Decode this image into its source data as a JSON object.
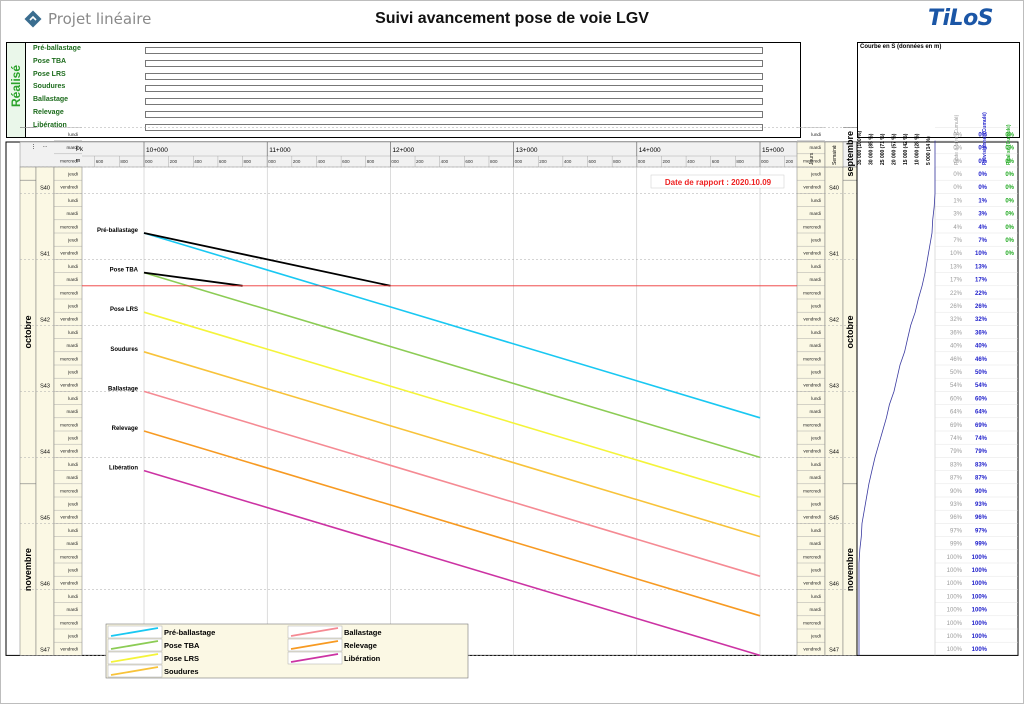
{
  "header": {
    "logo_text": "Projet linéaire",
    "title": "Suivi avancement pose de voie LGV",
    "brand": "TiLoS"
  },
  "realise": {
    "label": "Réalisé",
    "tasks": [
      "Pré-ballastage",
      "Pose TBA",
      "Pose LRS",
      "Soudures",
      "Ballastage",
      "Relevage",
      "Libération"
    ]
  },
  "axis": {
    "pk_label": "Pk",
    "m_label": "m",
    "pk_major": [
      "10+000",
      "11+000",
      "12+000",
      "13+000",
      "14+000",
      "15+000"
    ],
    "pk_minor": [
      "800",
      "900",
      "200",
      "400",
      "600",
      "800"
    ],
    "pk_minor_right": [
      "000",
      "200"
    ],
    "jours_label": "Jours",
    "semaine_label": "Semaine"
  },
  "calendar": {
    "weeks": [
      "...",
      "S40",
      "S41",
      "S42",
      "S43",
      "S44",
      "S45",
      "S46",
      "S47"
    ],
    "days_first_week": [
      "lundi",
      "mardi",
      "mercredi"
    ],
    "days_s40": [
      "jeudi",
      "vendredi"
    ],
    "days": [
      "lundi",
      "mardi",
      "mercredi",
      "jeudi",
      "vendredi"
    ],
    "months": [
      "septembre",
      "octobre",
      "novembre"
    ]
  },
  "report_date": "Date de rapport : 2020.10.09",
  "s_curve": {
    "title": "Courbe en S (données en m)",
    "scale_labels": [
      "35 000 (100 %)",
      "30 000 (85 %)",
      "25 000 (71 %)",
      "20 000 (57 %)",
      "15 000 (42 %)",
      "10 000 (28 %)",
      "5 000 (14 %)"
    ],
    "col_reste": "Reste à faire (Cumulé)",
    "col_prev": "Prévisionnel (Cumulé)",
    "col_real": "Réalisé (Cumulé)",
    "rows": [
      {
        "r": "0%",
        "p": "0%",
        "q": "0%"
      },
      {
        "r": "0%",
        "p": "0%",
        "q": "0%"
      },
      {
        "r": "0%",
        "p": "0%",
        "q": "0%"
      },
      {
        "r": "0%",
        "p": "0%",
        "q": "0%"
      },
      {
        "r": "0%",
        "p": "0%",
        "q": "0%"
      },
      {
        "r": "1%",
        "p": "1%",
        "q": "0%"
      },
      {
        "r": "3%",
        "p": "3%",
        "q": "0%"
      },
      {
        "r": "4%",
        "p": "4%",
        "q": "0%"
      },
      {
        "r": "7%",
        "p": "7%",
        "q": "0%"
      },
      {
        "r": "10%",
        "p": "10%",
        "q": "0%"
      },
      {
        "r": "13%",
        "p": "13%",
        "q": ""
      },
      {
        "r": "17%",
        "p": "17%",
        "q": ""
      },
      {
        "r": "22%",
        "p": "22%",
        "q": ""
      },
      {
        "r": "26%",
        "p": "26%",
        "q": ""
      },
      {
        "r": "32%",
        "p": "32%",
        "q": ""
      },
      {
        "r": "36%",
        "p": "36%",
        "q": ""
      },
      {
        "r": "40%",
        "p": "40%",
        "q": ""
      },
      {
        "r": "46%",
        "p": "46%",
        "q": ""
      },
      {
        "r": "50%",
        "p": "50%",
        "q": ""
      },
      {
        "r": "54%",
        "p": "54%",
        "q": ""
      },
      {
        "r": "60%",
        "p": "60%",
        "q": ""
      },
      {
        "r": "64%",
        "p": "64%",
        "q": ""
      },
      {
        "r": "69%",
        "p": "69%",
        "q": ""
      },
      {
        "r": "74%",
        "p": "74%",
        "q": ""
      },
      {
        "r": "79%",
        "p": "79%",
        "q": ""
      },
      {
        "r": "83%",
        "p": "83%",
        "q": ""
      },
      {
        "r": "87%",
        "p": "87%",
        "q": ""
      },
      {
        "r": "90%",
        "p": "90%",
        "q": ""
      },
      {
        "r": "93%",
        "p": "93%",
        "q": ""
      },
      {
        "r": "96%",
        "p": "96%",
        "q": ""
      },
      {
        "r": "97%",
        "p": "97%",
        "q": ""
      },
      {
        "r": "99%",
        "p": "99%",
        "q": ""
      },
      {
        "r": "100%",
        "p": "100%",
        "q": ""
      },
      {
        "r": "100%",
        "p": "100%",
        "q": ""
      },
      {
        "r": "100%",
        "p": "100%",
        "q": ""
      },
      {
        "r": "100%",
        "p": "100%",
        "q": ""
      },
      {
        "r": "100%",
        "p": "100%",
        "q": ""
      },
      {
        "r": "100%",
        "p": "100%",
        "q": ""
      },
      {
        "r": "100%",
        "p": "100%",
        "q": ""
      },
      {
        "r": "100%",
        "p": "100%",
        "q": ""
      }
    ]
  },
  "legend": [
    {
      "name": "Pré-ballastage",
      "color": "#19c8f2"
    },
    {
      "name": "Pose TBA",
      "color": "#8ccc55"
    },
    {
      "name": "Pose LRS",
      "color": "#f4f43a"
    },
    {
      "name": "Soudures",
      "color": "#f8c33a"
    },
    {
      "name": "Ballastage",
      "color": "#f58a93"
    },
    {
      "name": "Relevage",
      "color": "#f79a22"
    },
    {
      "name": "Libération",
      "color": "#cc33a3"
    }
  ],
  "colors": {
    "realise_line": "#000000",
    "report_line": "#ee3333",
    "report_text": "#ee2222",
    "s_curve": "#3a3aa0",
    "prev_col": "#2222cc",
    "real_col": "#22aa22",
    "reste_col": "#9a9a9a"
  },
  "chart_data": {
    "type": "line",
    "title": "Suivi avancement pose de voie LGV",
    "xlabel": "Pk",
    "ylabel": "",
    "x_unit": "Pk (m)",
    "y_unit": "working day (from Monday of week S40 = 0)",
    "xlim": [
      9400,
      15300
    ],
    "report_day": 9,
    "series": [
      {
        "name": "Pré-ballastage",
        "color": "#19c8f2",
        "x": [
          10000,
          15000
        ],
        "y": [
          5,
          19
        ]
      },
      {
        "name": "Pose TBA",
        "color": "#8ccc55",
        "x": [
          10000,
          15000
        ],
        "y": [
          8,
          22
        ]
      },
      {
        "name": "Pose LRS",
        "color": "#f4f43a",
        "x": [
          10000,
          15000
        ],
        "y": [
          11,
          25
        ]
      },
      {
        "name": "Soudures",
        "color": "#f8c33a",
        "x": [
          10000,
          15000
        ],
        "y": [
          14,
          28
        ]
      },
      {
        "name": "Ballastage",
        "color": "#f58a93",
        "x": [
          10000,
          15000
        ],
        "y": [
          17,
          31
        ]
      },
      {
        "name": "Relevage",
        "color": "#f79a22",
        "x": [
          10000,
          15000
        ],
        "y": [
          20,
          34
        ]
      },
      {
        "name": "Libération",
        "color": "#cc33a3",
        "x": [
          10000,
          15000
        ],
        "y": [
          23,
          37
        ]
      }
    ],
    "realised": [
      {
        "name": "Pré-ballastage",
        "x": [
          10000,
          11000,
          12000
        ],
        "y": [
          5,
          7,
          9
        ]
      },
      {
        "name": "Pose TBA",
        "x": [
          10000,
          10800
        ],
        "y": [
          8,
          9
        ]
      }
    ],
    "s_curve_prev_pct": [
      0,
      0,
      0,
      0,
      0,
      1,
      3,
      4,
      7,
      10,
      13,
      17,
      22,
      26,
      32,
      36,
      40,
      46,
      50,
      54,
      60,
      64,
      69,
      74,
      79,
      83,
      87,
      90,
      93,
      96,
      97,
      99,
      100,
      100,
      100,
      100,
      100,
      100,
      100,
      100
    ]
  }
}
